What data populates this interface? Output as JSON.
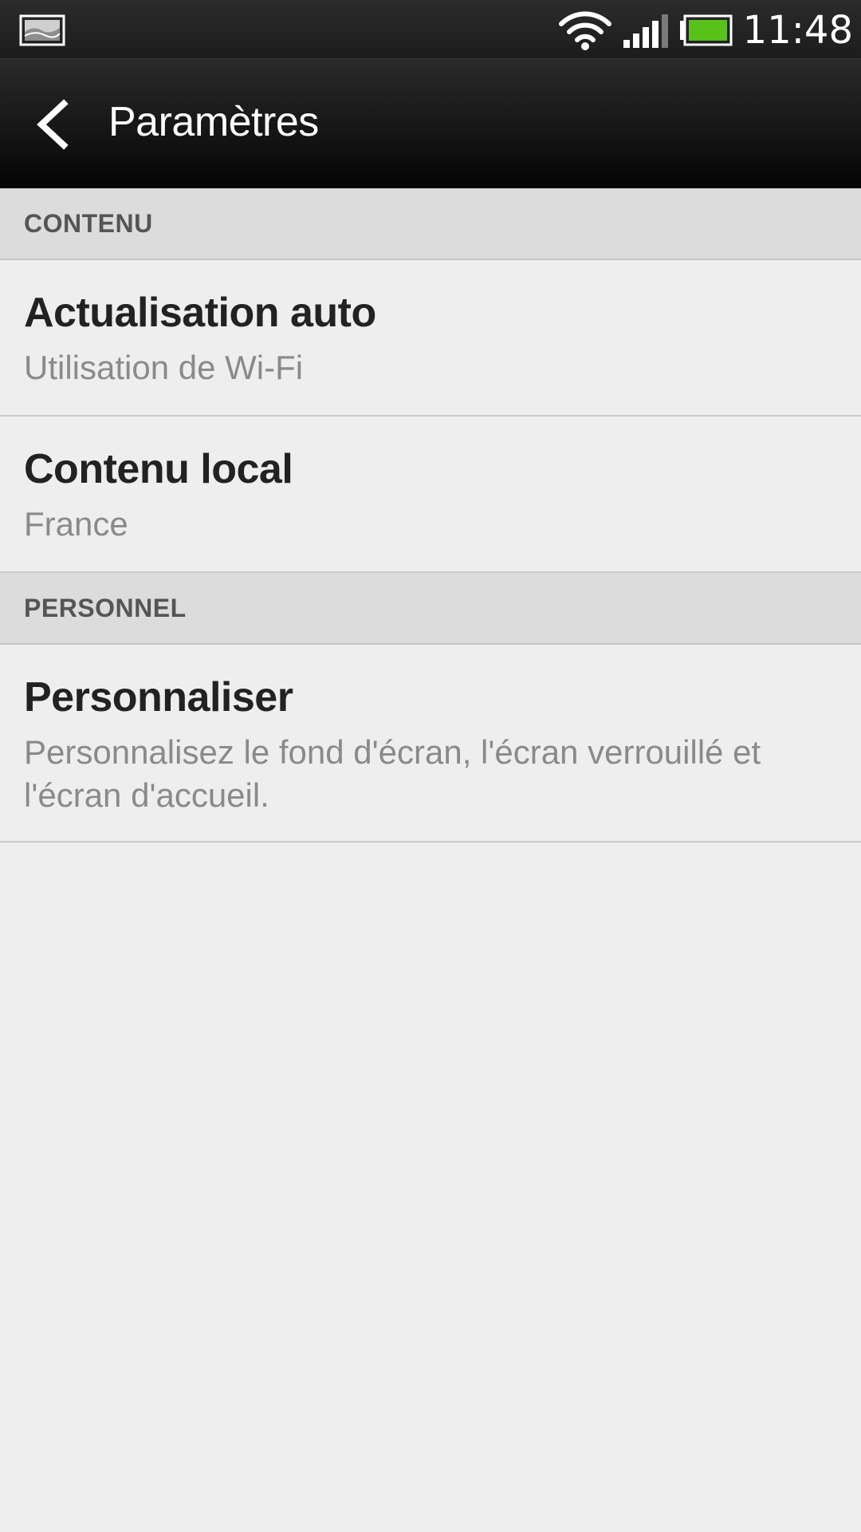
{
  "status_bar": {
    "time": "11:48",
    "icons": [
      "image-notification-icon",
      "wifi-icon",
      "signal-icon",
      "battery-icon"
    ],
    "battery_color": "#58c21a"
  },
  "action_bar": {
    "title": "Paramètres",
    "back_icon": "chevron-left-icon"
  },
  "sections": [
    {
      "header": "CONTENU",
      "items": [
        {
          "title": "Actualisation auto",
          "subtitle": "Utilisation de Wi-Fi"
        },
        {
          "title": "Contenu local",
          "subtitle": "France"
        }
      ]
    },
    {
      "header": "PERSONNEL",
      "items": [
        {
          "title": "Personnaliser",
          "subtitle": "Personnalisez le fond d'écran, l'écran verrouillé et l'écran d'accueil."
        }
      ]
    }
  ]
}
